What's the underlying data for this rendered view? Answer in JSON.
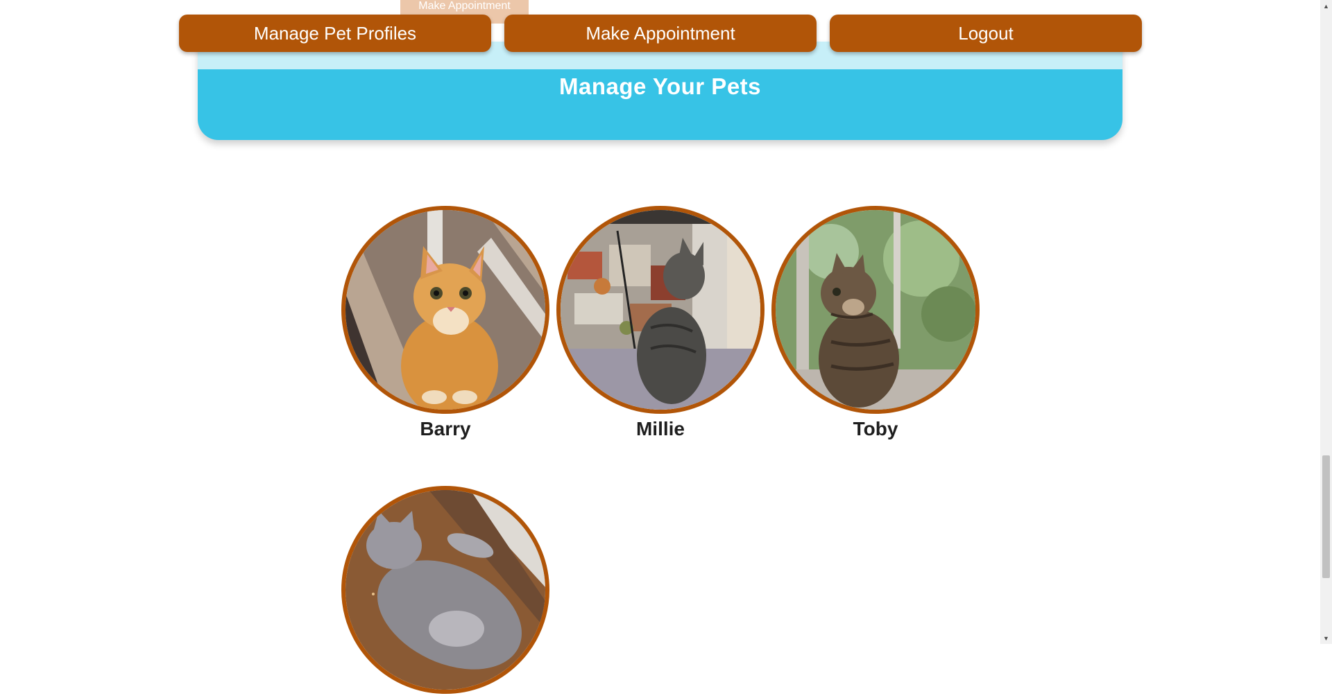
{
  "ghost_tab": {
    "label": "Make Appointment"
  },
  "nav": {
    "buttons": [
      {
        "label": "Manage Pet Profiles"
      },
      {
        "label": "Make Appointment"
      },
      {
        "label": "Logout"
      }
    ]
  },
  "hero": {
    "title": "Manage Your Pets"
  },
  "pets": [
    {
      "name": "Barry"
    },
    {
      "name": "Millie"
    },
    {
      "name": "Toby"
    },
    {
      "name": ""
    }
  ],
  "colors": {
    "brand_orange": "#b15508",
    "hero_blue": "#37c3e6",
    "hero_band": "#c7eff8"
  },
  "scrollbar": {
    "up_icon": "triangle-up",
    "down_icon": "triangle-down"
  }
}
